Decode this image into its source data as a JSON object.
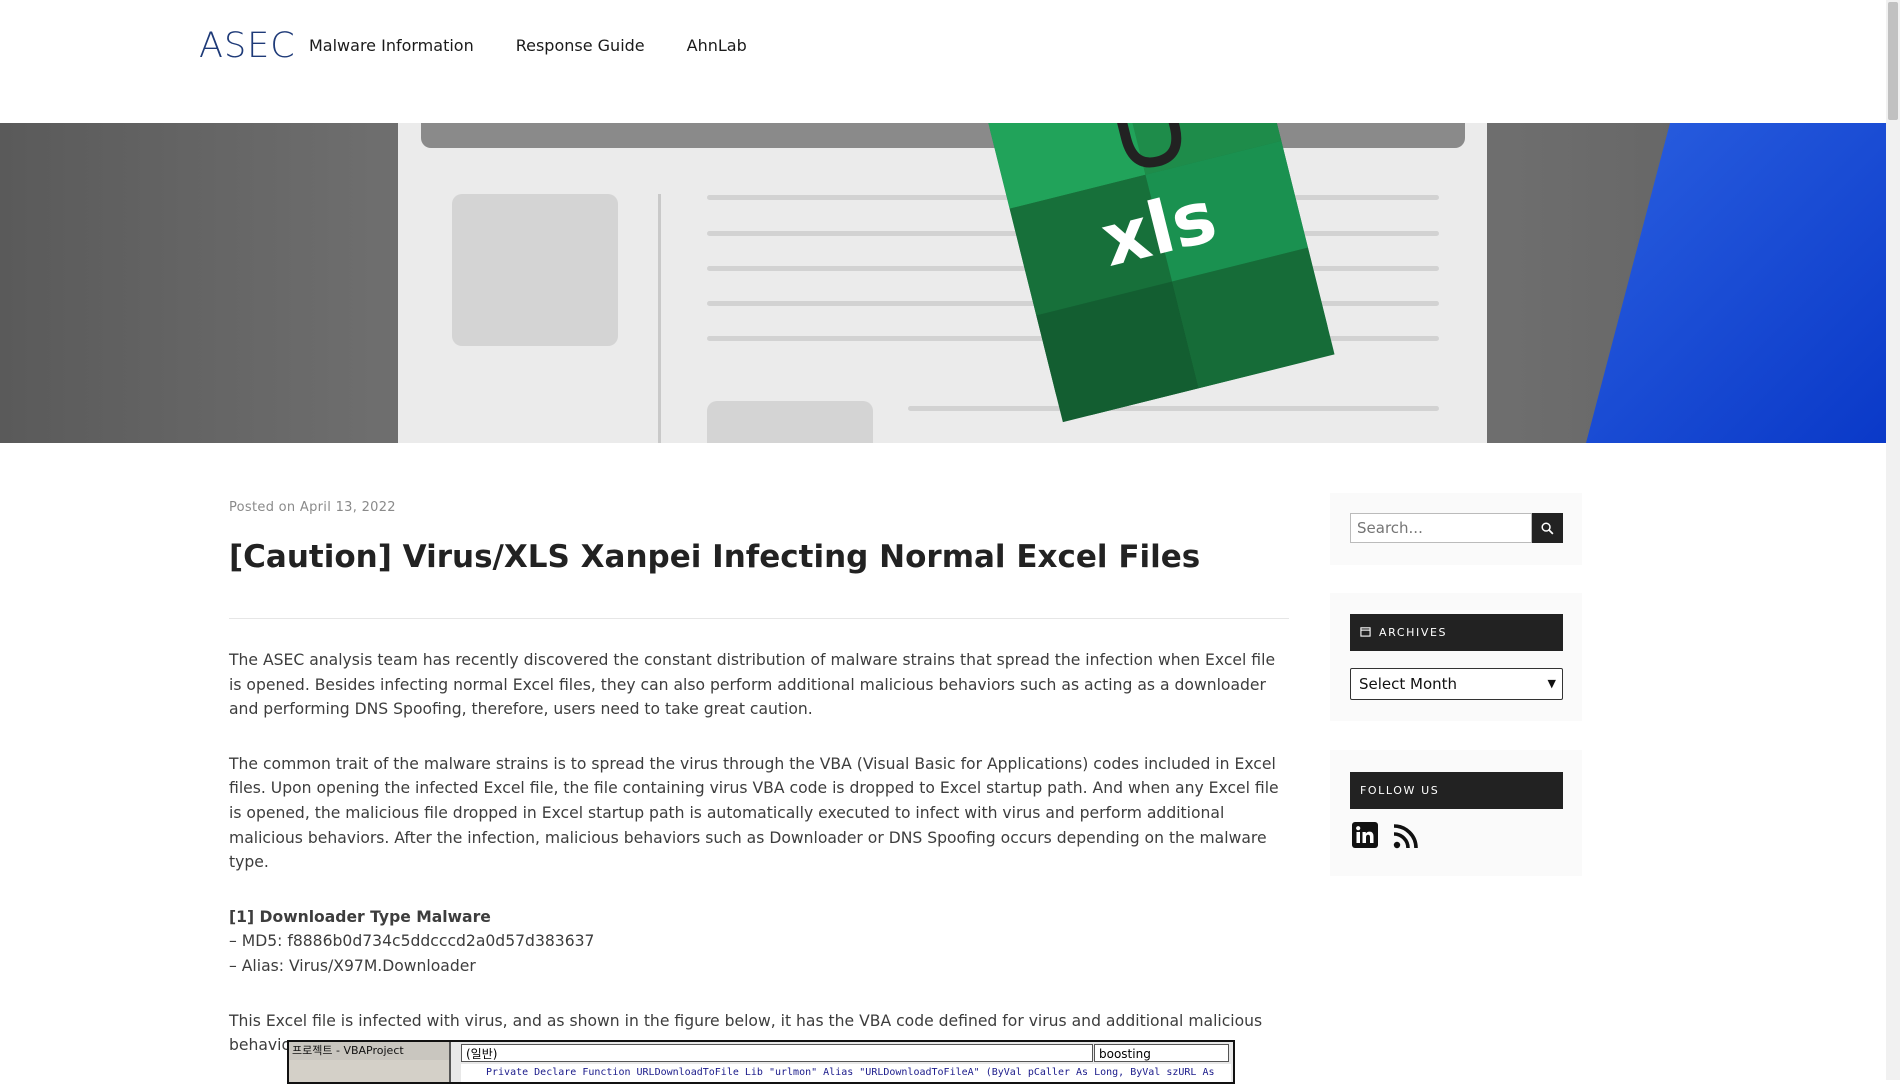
{
  "header": {
    "logo": "ASEC",
    "nav": [
      "Malware Information",
      "Response Guide",
      "AhnLab"
    ]
  },
  "hero": {
    "badge": "xls"
  },
  "article": {
    "posted_prefix": "Posted on",
    "date": "April 13, 2022",
    "title": "[Caution] Virus/XLS Xanpei Infecting Normal Excel Files",
    "paragraphs": [
      "The ASEC analysis team has recently discovered the constant distribution of malware strains that spread the infection when Excel file is opened. Besides infecting normal Excel files, they can also perform additional malicious behaviors such as acting as a downloader and performing DNS Spoofing, therefore, users need to take great caution.",
      "The common trait of the malware strains is to spread the virus through the VBA (Visual Basic for Applications) codes included in Excel files. Upon opening the infected Excel file, the file containing virus VBA code is dropped to Excel startup path. And when any Excel file is opened, the malicious file dropped in Excel startup path is automatically executed to infect with virus and perform additional malicious behaviors. After the infection, malicious behaviors such as Downloader or DNS Spoofing occurs depending on the malware type."
    ],
    "section_heading": "[1] Downloader Type Malware",
    "md5": "– MD5: f8886b0d734c5ddcccd2a0d57d383637",
    "alias": "– Alias: Virus/X97M.Downloader",
    "paragraph_after": "This Excel file is infected with virus, and as shown in the figure below, it has the VBA code defined for virus and additional malicious behaviors.",
    "screenshot": {
      "project_title": "프로젝트 - VBAProject",
      "combo_left": "(일반)",
      "combo_right": "boosting",
      "code_line": "Private Declare Function URLDownloadToFile Lib \"urlmon\" Alias \"URLDownloadToFileA\" (ByVal pCaller As Long, ByVal szURL As"
    }
  },
  "sidebar": {
    "search_placeholder": "Search...",
    "archives_title": "ARCHIVES",
    "archives_select": "Select Month",
    "follow_title": "FOLLOW US",
    "social_icons": [
      "linkedin-icon",
      "rss-icon"
    ]
  },
  "colors": {
    "brand": "#1e3a78",
    "widget_header": "#222222",
    "hero_blue": "#0a39c8",
    "excel_green": "#1e8c4a"
  }
}
